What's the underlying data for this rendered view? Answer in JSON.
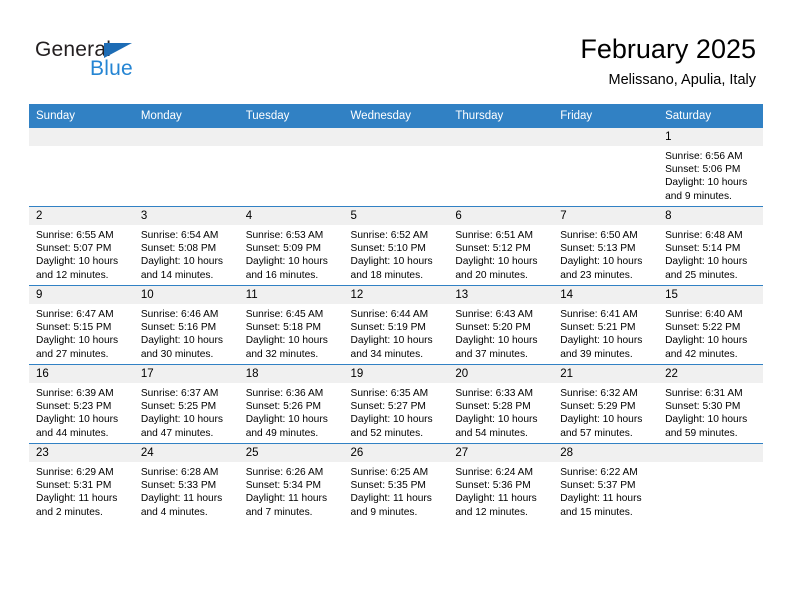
{
  "brand": {
    "name_part1": "General",
    "name_part2": "Blue",
    "triangle_icon": "triangle-icon",
    "primary_color": "#3181c4",
    "blue_text_color": "#2585d3"
  },
  "header": {
    "month_title": "February 2025",
    "location": "Melissano, Apulia, Italy"
  },
  "weekday_headers": [
    "Sunday",
    "Monday",
    "Tuesday",
    "Wednesday",
    "Thursday",
    "Friday",
    "Saturday"
  ],
  "weeks": [
    [
      {
        "day": "",
        "lines": []
      },
      {
        "day": "",
        "lines": []
      },
      {
        "day": "",
        "lines": []
      },
      {
        "day": "",
        "lines": []
      },
      {
        "day": "",
        "lines": []
      },
      {
        "day": "",
        "lines": []
      },
      {
        "day": "1",
        "lines": [
          "Sunrise: 6:56 AM",
          "Sunset: 5:06 PM",
          "Daylight: 10 hours",
          "and 9 minutes."
        ]
      }
    ],
    [
      {
        "day": "2",
        "lines": [
          "Sunrise: 6:55 AM",
          "Sunset: 5:07 PM",
          "Daylight: 10 hours",
          "and 12 minutes."
        ]
      },
      {
        "day": "3",
        "lines": [
          "Sunrise: 6:54 AM",
          "Sunset: 5:08 PM",
          "Daylight: 10 hours",
          "and 14 minutes."
        ]
      },
      {
        "day": "4",
        "lines": [
          "Sunrise: 6:53 AM",
          "Sunset: 5:09 PM",
          "Daylight: 10 hours",
          "and 16 minutes."
        ]
      },
      {
        "day": "5",
        "lines": [
          "Sunrise: 6:52 AM",
          "Sunset: 5:10 PM",
          "Daylight: 10 hours",
          "and 18 minutes."
        ]
      },
      {
        "day": "6",
        "lines": [
          "Sunrise: 6:51 AM",
          "Sunset: 5:12 PM",
          "Daylight: 10 hours",
          "and 20 minutes."
        ]
      },
      {
        "day": "7",
        "lines": [
          "Sunrise: 6:50 AM",
          "Sunset: 5:13 PM",
          "Daylight: 10 hours",
          "and 23 minutes."
        ]
      },
      {
        "day": "8",
        "lines": [
          "Sunrise: 6:48 AM",
          "Sunset: 5:14 PM",
          "Daylight: 10 hours",
          "and 25 minutes."
        ]
      }
    ],
    [
      {
        "day": "9",
        "lines": [
          "Sunrise: 6:47 AM",
          "Sunset: 5:15 PM",
          "Daylight: 10 hours",
          "and 27 minutes."
        ]
      },
      {
        "day": "10",
        "lines": [
          "Sunrise: 6:46 AM",
          "Sunset: 5:16 PM",
          "Daylight: 10 hours",
          "and 30 minutes."
        ]
      },
      {
        "day": "11",
        "lines": [
          "Sunrise: 6:45 AM",
          "Sunset: 5:18 PM",
          "Daylight: 10 hours",
          "and 32 minutes."
        ]
      },
      {
        "day": "12",
        "lines": [
          "Sunrise: 6:44 AM",
          "Sunset: 5:19 PM",
          "Daylight: 10 hours",
          "and 34 minutes."
        ]
      },
      {
        "day": "13",
        "lines": [
          "Sunrise: 6:43 AM",
          "Sunset: 5:20 PM",
          "Daylight: 10 hours",
          "and 37 minutes."
        ]
      },
      {
        "day": "14",
        "lines": [
          "Sunrise: 6:41 AM",
          "Sunset: 5:21 PM",
          "Daylight: 10 hours",
          "and 39 minutes."
        ]
      },
      {
        "day": "15",
        "lines": [
          "Sunrise: 6:40 AM",
          "Sunset: 5:22 PM",
          "Daylight: 10 hours",
          "and 42 minutes."
        ]
      }
    ],
    [
      {
        "day": "16",
        "lines": [
          "Sunrise: 6:39 AM",
          "Sunset: 5:23 PM",
          "Daylight: 10 hours",
          "and 44 minutes."
        ]
      },
      {
        "day": "17",
        "lines": [
          "Sunrise: 6:37 AM",
          "Sunset: 5:25 PM",
          "Daylight: 10 hours",
          "and 47 minutes."
        ]
      },
      {
        "day": "18",
        "lines": [
          "Sunrise: 6:36 AM",
          "Sunset: 5:26 PM",
          "Daylight: 10 hours",
          "and 49 minutes."
        ]
      },
      {
        "day": "19",
        "lines": [
          "Sunrise: 6:35 AM",
          "Sunset: 5:27 PM",
          "Daylight: 10 hours",
          "and 52 minutes."
        ]
      },
      {
        "day": "20",
        "lines": [
          "Sunrise: 6:33 AM",
          "Sunset: 5:28 PM",
          "Daylight: 10 hours",
          "and 54 minutes."
        ]
      },
      {
        "day": "21",
        "lines": [
          "Sunrise: 6:32 AM",
          "Sunset: 5:29 PM",
          "Daylight: 10 hours",
          "and 57 minutes."
        ]
      },
      {
        "day": "22",
        "lines": [
          "Sunrise: 6:31 AM",
          "Sunset: 5:30 PM",
          "Daylight: 10 hours",
          "and 59 minutes."
        ]
      }
    ],
    [
      {
        "day": "23",
        "lines": [
          "Sunrise: 6:29 AM",
          "Sunset: 5:31 PM",
          "Daylight: 11 hours",
          "and 2 minutes."
        ]
      },
      {
        "day": "24",
        "lines": [
          "Sunrise: 6:28 AM",
          "Sunset: 5:33 PM",
          "Daylight: 11 hours",
          "and 4 minutes."
        ]
      },
      {
        "day": "25",
        "lines": [
          "Sunrise: 6:26 AM",
          "Sunset: 5:34 PM",
          "Daylight: 11 hours",
          "and 7 minutes."
        ]
      },
      {
        "day": "26",
        "lines": [
          "Sunrise: 6:25 AM",
          "Sunset: 5:35 PM",
          "Daylight: 11 hours",
          "and 9 minutes."
        ]
      },
      {
        "day": "27",
        "lines": [
          "Sunrise: 6:24 AM",
          "Sunset: 5:36 PM",
          "Daylight: 11 hours",
          "and 12 minutes."
        ]
      },
      {
        "day": "28",
        "lines": [
          "Sunrise: 6:22 AM",
          "Sunset: 5:37 PM",
          "Daylight: 11 hours",
          "and 15 minutes."
        ]
      },
      {
        "day": "",
        "lines": []
      }
    ]
  ]
}
